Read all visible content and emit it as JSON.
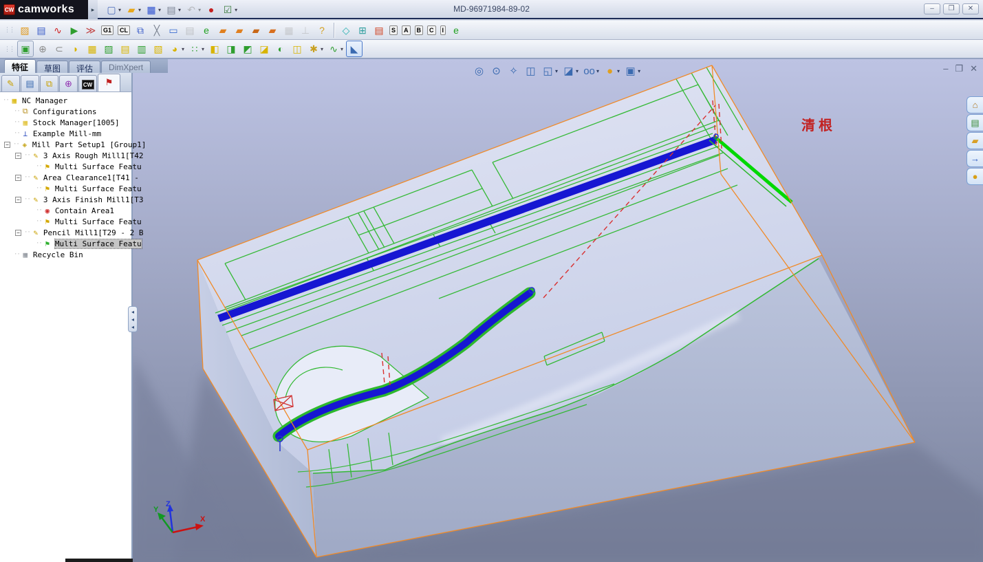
{
  "window": {
    "logo_text": "camworks",
    "logo_badge": "CW",
    "title": "MD-96971984-89-02",
    "controls": [
      {
        "name": "minimize",
        "glyph": "–"
      },
      {
        "name": "restore",
        "glyph": "❐"
      },
      {
        "name": "close",
        "glyph": "✕"
      }
    ]
  },
  "toolbars": {
    "standard": [
      {
        "name": "new-document",
        "glyph": "▢",
        "color": "#4a6ab8",
        "dropdown": true
      },
      {
        "name": "open",
        "glyph": "▰",
        "color": "#e8a81c",
        "dropdown": true
      },
      {
        "name": "save",
        "glyph": "▦",
        "color": "#2b4fd0",
        "dropdown": true
      },
      {
        "name": "print",
        "glyph": "▤",
        "color": "#7c8494",
        "dropdown": true
      },
      {
        "name": "undo",
        "glyph": "↶",
        "color": "#8a94a8",
        "dropdown": true,
        "disabled": true
      },
      {
        "name": "traffic-light",
        "glyph": "●",
        "color": "#c42020"
      },
      {
        "name": "options-list",
        "glyph": "☑",
        "color": "#3a7a3a",
        "dropdown": true
      }
    ],
    "camworks": [
      {
        "name": "extract-machinable-features",
        "glyph": "▨",
        "color": "#e09a20"
      },
      {
        "name": "generate-operation-plan",
        "glyph": "▤",
        "color": "#3a5cc8"
      },
      {
        "name": "generate-toolpath",
        "glyph": "∿",
        "color": "#d02020"
      },
      {
        "name": "simulate-toolpath",
        "glyph": "▶",
        "color": "#2f9e2f"
      },
      {
        "name": "step-through-toolpath",
        "glyph": "≫",
        "color": "#c04040"
      },
      {
        "name": "post-process",
        "text": "G1"
      },
      {
        "name": "cl-file",
        "text": "CL"
      },
      {
        "name": "publish-documents",
        "glyph": "⧉",
        "color": "#3a5cc8"
      },
      {
        "name": "camworks-tools",
        "glyph": "╳",
        "color": "#78808e"
      },
      {
        "name": "message-window",
        "glyph": "▭",
        "color": "#3a6cd0"
      },
      {
        "name": "nc-editor",
        "glyph": "▤",
        "color": "#9aa2b0",
        "disabled": true
      },
      {
        "name": "e-speed",
        "glyph": "e",
        "color": "#20a020"
      },
      {
        "name": "save-operations-1",
        "glyph": "▰",
        "color": "#e08020"
      },
      {
        "name": "save-operations-2",
        "glyph": "▰",
        "color": "#e08020"
      },
      {
        "name": "save-operations-3",
        "glyph": "▰",
        "color": "#c86818"
      },
      {
        "name": "save-operations-4",
        "glyph": "▰",
        "color": "#d87020"
      },
      {
        "name": "machine-simulation",
        "glyph": "▦",
        "color": "#a8aeb8",
        "disabled": true
      },
      {
        "name": "fixture",
        "glyph": "⊥",
        "color": "#a8aeb8",
        "disabled": true
      },
      {
        "name": "help",
        "glyph": "?",
        "color": "#d4a020"
      },
      {
        "separator": true
      },
      {
        "name": "feature-associativity",
        "glyph": "◇",
        "color": "#28b0b0"
      },
      {
        "name": "check-items",
        "glyph": "⊞",
        "color": "#2f9e9e"
      },
      {
        "name": "rebuild-data",
        "glyph": "▤",
        "color": "#d04020"
      },
      {
        "name": "view-s",
        "text": "S"
      },
      {
        "name": "view-a",
        "text": "A"
      },
      {
        "name": "view-b",
        "text": "B"
      },
      {
        "name": "view-c",
        "text": "C"
      },
      {
        "name": "view-i",
        "text": "I"
      },
      {
        "name": "e-speed-2",
        "glyph": "e",
        "color": "#20a020"
      }
    ],
    "features": [
      {
        "name": "extruded-boss",
        "glyph": "▣",
        "color": "#2f9e2f",
        "pressed": true
      },
      {
        "name": "revolved-boss",
        "glyph": "⊕",
        "color": "#8a8a8a"
      },
      {
        "name": "swept-boss",
        "glyph": "⊂",
        "color": "#8a8a8a"
      },
      {
        "name": "lofted-boss",
        "glyph": "◗",
        "color": "#d8b400"
      },
      {
        "name": "extruded-cut",
        "glyph": "▦",
        "color": "#d8b400"
      },
      {
        "name": "hole-wizard",
        "glyph": "▨",
        "color": "#2f9e2f"
      },
      {
        "name": "revolved-cut",
        "glyph": "▤",
        "color": "#d8b400"
      },
      {
        "name": "swept-cut",
        "glyph": "▥",
        "color": "#2f9e2f"
      },
      {
        "name": "lofted-cut",
        "glyph": "▧",
        "color": "#d8b400"
      },
      {
        "name": "fillet",
        "glyph": "◕",
        "color": "#d8b400",
        "dropdown": true
      },
      {
        "name": "linear-pattern",
        "glyph": "∷",
        "color": "#2f9e2f",
        "dropdown": true
      },
      {
        "name": "rib",
        "glyph": "◧",
        "color": "#d8b400"
      },
      {
        "name": "draft",
        "glyph": "◨",
        "color": "#2f9e2f"
      },
      {
        "name": "shell",
        "glyph": "◩",
        "color": "#2f9e2f"
      },
      {
        "name": "wrap",
        "glyph": "◪",
        "color": "#d8b400"
      },
      {
        "name": "dome",
        "glyph": "◐",
        "color": "#2f9e2f"
      },
      {
        "name": "mirror",
        "glyph": "◫",
        "color": "#d8b400"
      },
      {
        "name": "reference-geometry",
        "glyph": "✱",
        "color": "#c8a020",
        "dropdown": true
      },
      {
        "name": "curves",
        "glyph": "∿",
        "color": "#2f9e2f",
        "dropdown": true
      },
      {
        "name": "instant3d",
        "glyph": "◣",
        "color": "#3a6ab0",
        "highlight": true
      }
    ]
  },
  "command_tabs": [
    {
      "label": "特征",
      "state": "active"
    },
    {
      "label": "草图",
      "state": "normal"
    },
    {
      "label": "评估",
      "state": "normal"
    },
    {
      "label": "DimXpert",
      "state": "dim"
    }
  ],
  "manager_tabs": [
    {
      "name": "camworks-feature-tree",
      "glyph": "✎",
      "color": "#c8a000"
    },
    {
      "name": "property-manager",
      "glyph": "▤",
      "color": "#3a6ab0"
    },
    {
      "name": "configuration-manager",
      "glyph": "⧉",
      "color": "#c8a000"
    },
    {
      "name": "dimxpert-manager",
      "glyph": "⊕",
      "color": "#9030b0"
    },
    {
      "name": "camworks-tree",
      "cw": "CW"
    },
    {
      "name": "camworks-operation-tree",
      "glyph": "⚑",
      "color": "#c02020",
      "active": true
    }
  ],
  "tree": {
    "items": [
      {
        "label": "NC Manager",
        "depth": 0,
        "icon": "box",
        "icon_glyph": "▦",
        "icon_color": "#d8b400"
      },
      {
        "label": "Configurations",
        "depth": 1,
        "icon": "configurations",
        "icon_glyph": "⧉",
        "icon_color": "#b89020"
      },
      {
        "label": "Stock Manager[1005]",
        "depth": 1,
        "icon": "stock",
        "icon_glyph": "▦",
        "icon_color": "#e0c030"
      },
      {
        "label": "Example Mill-mm",
        "depth": 1,
        "icon": "machine",
        "icon_glyph": "⊥",
        "icon_color": "#3050c0"
      },
      {
        "label": "Mill Part Setup1 [Group1]",
        "depth": 1,
        "expand": "-",
        "icon": "setup",
        "icon_glyph": "◈",
        "icon_color": "#c8a820"
      },
      {
        "label": "3 Axis Rough Mill1[T42",
        "depth": 2,
        "expand": "-",
        "icon": "operation",
        "icon_glyph": "✎",
        "icon_color": "#c8a000"
      },
      {
        "label": "Multi Surface Featu",
        "depth": 3,
        "icon": "feature",
        "icon_glyph": "⚑",
        "icon_color": "#d4a800"
      },
      {
        "label": "Area Clearance1[T41 -",
        "depth": 2,
        "expand": "-",
        "icon": "operation",
        "icon_glyph": "✎",
        "icon_color": "#c8a000"
      },
      {
        "label": "Multi Surface Featu",
        "depth": 3,
        "icon": "feature",
        "icon_glyph": "⚑",
        "icon_color": "#d4a800"
      },
      {
        "label": "3 Axis Finish Mill1[T3",
        "depth": 2,
        "expand": "-",
        "icon": "operation",
        "icon_glyph": "✎",
        "icon_color": "#c8a000"
      },
      {
        "label": "Contain Area1",
        "depth": 3,
        "icon": "contain-area",
        "icon_glyph": "◉",
        "icon_color": "#d03030"
      },
      {
        "label": "Multi Surface Featu",
        "depth": 3,
        "icon": "feature",
        "icon_glyph": "⚑",
        "icon_color": "#d4a800"
      },
      {
        "label": "Pencil Mill1[T29 - 2 B",
        "depth": 2,
        "expand": "-",
        "icon": "operation",
        "icon_glyph": "✎",
        "icon_color": "#c8a000"
      },
      {
        "label": "Multi Surface Featu",
        "depth": 3,
        "icon": "feature-selected",
        "icon_glyph": "⚑",
        "icon_color": "#30b030",
        "selected": true
      },
      {
        "label": "Recycle Bin",
        "depth": 1,
        "icon": "recycle-bin",
        "icon_glyph": "▦",
        "icon_color": "#8a9098"
      }
    ]
  },
  "viewport": {
    "hud": [
      {
        "name": "zoom-to-fit",
        "glyph": "◎"
      },
      {
        "name": "zoom-to-area",
        "glyph": "⊙"
      },
      {
        "name": "previous-view",
        "glyph": "✧"
      },
      {
        "name": "section-view",
        "glyph": "◫"
      },
      {
        "name": "view-orientation",
        "glyph": "◱",
        "dropdown": true
      },
      {
        "name": "display-style",
        "glyph": "◪",
        "dropdown": true
      },
      {
        "name": "hide-show-items",
        "glyph": "oo",
        "dropdown": true
      },
      {
        "name": "edit-appearance",
        "glyph": "●",
        "color": "#e0a020",
        "dropdown": true
      },
      {
        "name": "apply-scene",
        "glyph": "▣",
        "dropdown": true
      }
    ],
    "window_controls": [
      {
        "name": "minimize",
        "glyph": "–"
      },
      {
        "name": "restore",
        "glyph": "❐"
      },
      {
        "name": "close",
        "glyph": "✕"
      }
    ],
    "annotation": "清根",
    "triad": {
      "x_label": "X",
      "y_label": "Y",
      "z_label": "Z",
      "x_color": "#cc1111",
      "y_color": "#119922",
      "z_color": "#2233dd"
    },
    "colors": {
      "background_top": "#bdc3e3",
      "background_bottom": "#79829c",
      "part_top": "#dadef0",
      "part_front": "#aeb8d2",
      "stock_box_orange": "#f08a28",
      "wireframe_green": "#2eb82e",
      "toolpath_band_blue": "#1616d2",
      "toolpath_highlight_green": "#00d800",
      "retract_dash_red": "#d83030",
      "annotation_red": "#c22222"
    }
  },
  "task_pane": [
    {
      "name": "solidworks-resources",
      "glyph": "⌂",
      "color": "#b07820"
    },
    {
      "name": "design-library",
      "glyph": "▤",
      "color": "#3a8a3a"
    },
    {
      "name": "file-explorer",
      "glyph": "▰",
      "color": "#d8a028"
    },
    {
      "name": "view-palette",
      "glyph": "→",
      "color": "#2858c0"
    },
    {
      "name": "appearances-scenes",
      "glyph": "●",
      "color": "#d8a018"
    }
  ]
}
